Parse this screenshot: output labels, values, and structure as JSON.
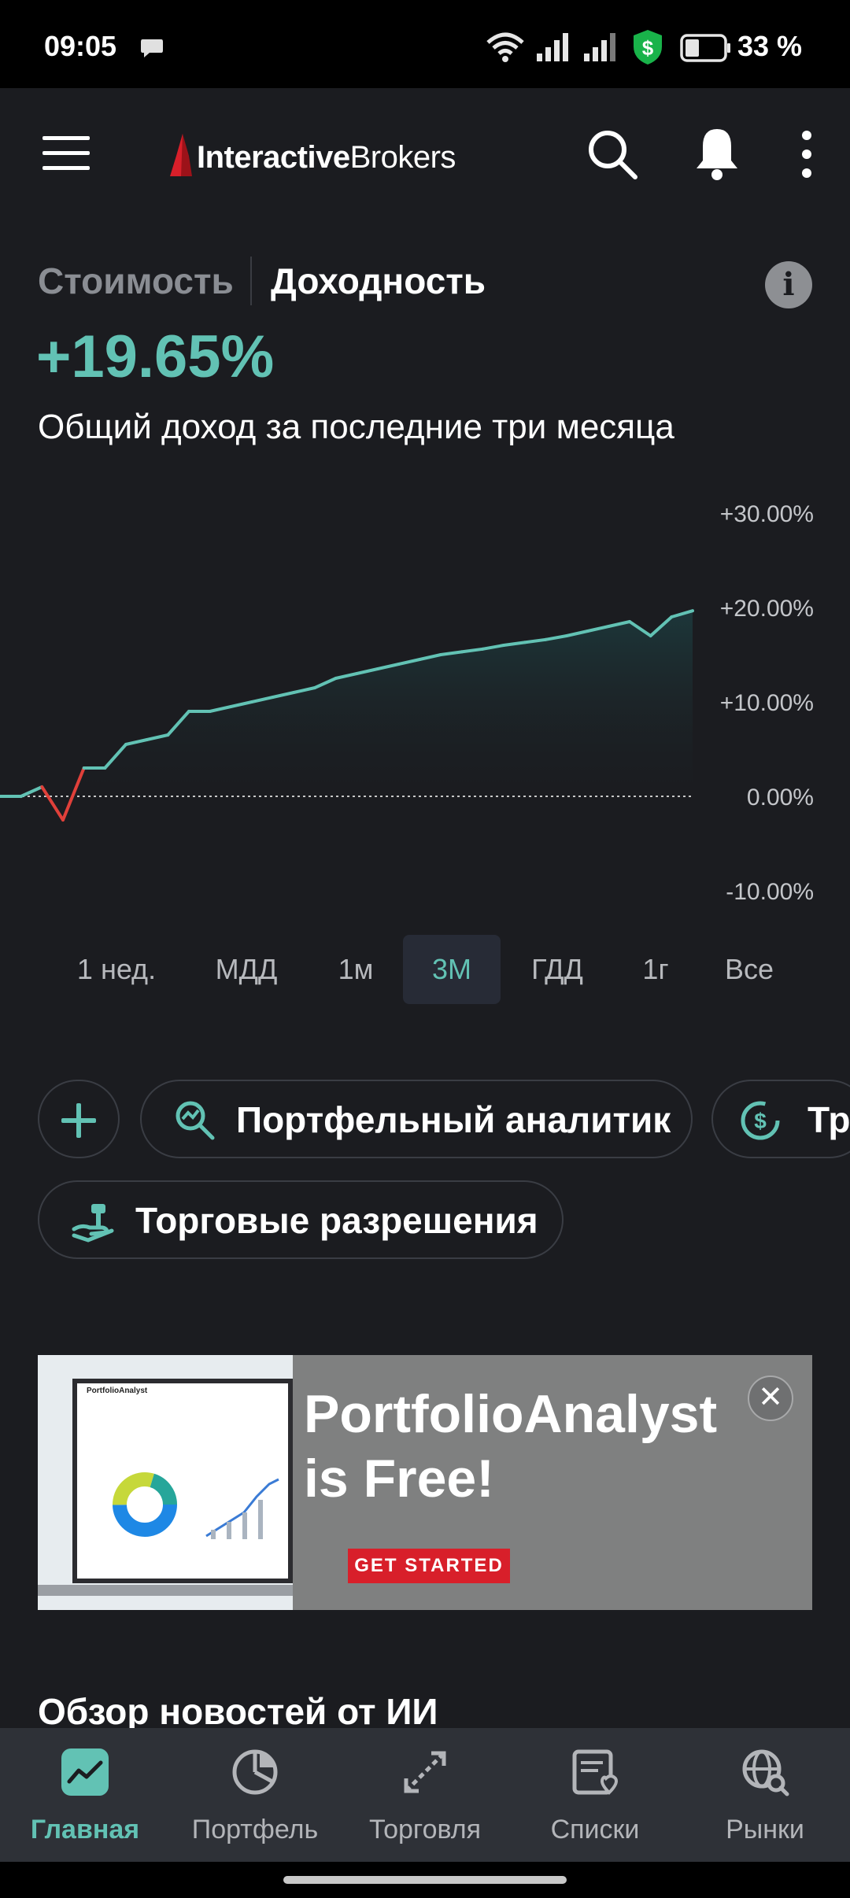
{
  "status_bar": {
    "time": "09:05",
    "battery": "33 %",
    "icons": [
      "chat-bubble-icon",
      "wifi-icon",
      "signal-icon",
      "signal-icon-2",
      "shield-dollar-icon",
      "battery-icon"
    ]
  },
  "app_bar": {
    "brand_bold": "Interactive",
    "brand_regular": "Brokers",
    "icons": [
      "menu-icon",
      "search-icon",
      "bell-icon",
      "more-vertical-icon"
    ]
  },
  "performance": {
    "tab_value": "Стоимость",
    "tab_return": "Доходность",
    "return_value": "+19.65%",
    "caption": "Общий доход за последние три месяца",
    "accent_color": "#62c2b4",
    "negative_color": "#e0403a"
  },
  "chart_data": {
    "type": "area",
    "ylabel": "",
    "xlabel": "",
    "y_ticks": [
      "+30.00%",
      "+20.00%",
      "+10.00%",
      "0.00%",
      "-10.00%"
    ],
    "ylim": [
      -10,
      30
    ],
    "baseline": 0,
    "grid": false,
    "series": [
      {
        "values": [
          0,
          0,
          1,
          -2.5,
          3,
          3,
          5.5,
          6,
          6.5,
          9,
          9,
          9.5,
          10,
          10.5,
          11,
          11.5,
          12.5,
          13,
          13.5,
          14,
          14.5,
          15,
          15.3,
          15.6,
          16,
          16.3,
          16.6,
          17,
          17.5,
          18,
          18.5,
          17,
          19,
          19.65
        ]
      }
    ]
  },
  "ranges": {
    "items": [
      "1 нед.",
      "МДД",
      "1м",
      "3М",
      "ГДД",
      "1г",
      "Все"
    ],
    "active": "3М"
  },
  "shortcuts": {
    "add_icon": "plus-icon",
    "portfolio_analyst": "Портфельный аналитик",
    "partial_chip": "Тр",
    "trading_permissions": "Торговые разрешения"
  },
  "banner": {
    "title_line1": "PortfolioAnalyst",
    "title_line2": "is Free!",
    "cta": "GET STARTED",
    "close": "✕",
    "preview_title": "PortfolioAnalyst"
  },
  "news": {
    "heading": "Обзор новостей от ИИ"
  },
  "bottom_nav": {
    "items": [
      "Главная",
      "Портфель",
      "Торговля",
      "Списки",
      "Рынки"
    ],
    "active": "Главная"
  }
}
